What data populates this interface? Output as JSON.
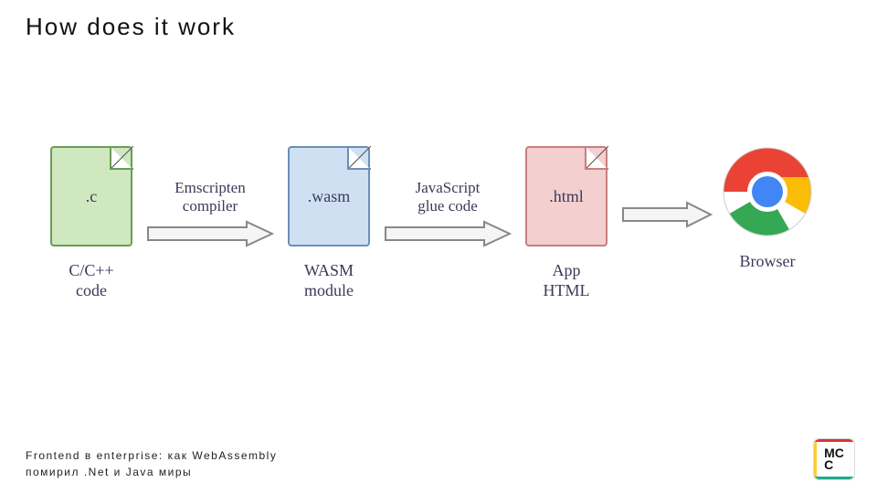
{
  "title": "How does it work",
  "stages": {
    "s1": {
      "ext": ".c",
      "caption": "C/C++\ncode"
    },
    "s2": {
      "ext": ".wasm",
      "caption": "WASM\nmodule"
    },
    "s3": {
      "ext": ".html",
      "caption": "App\nHTML"
    },
    "s4": {
      "caption": "Browser"
    }
  },
  "arrows": {
    "a1": "Emscripten\ncompiler",
    "a2": "JavaScript\nglue code",
    "a3": ""
  },
  "footer": "Frontend в enterprise: как WebAssembly\nпомирил .Net и Java миры",
  "logo": "MC\nC"
}
